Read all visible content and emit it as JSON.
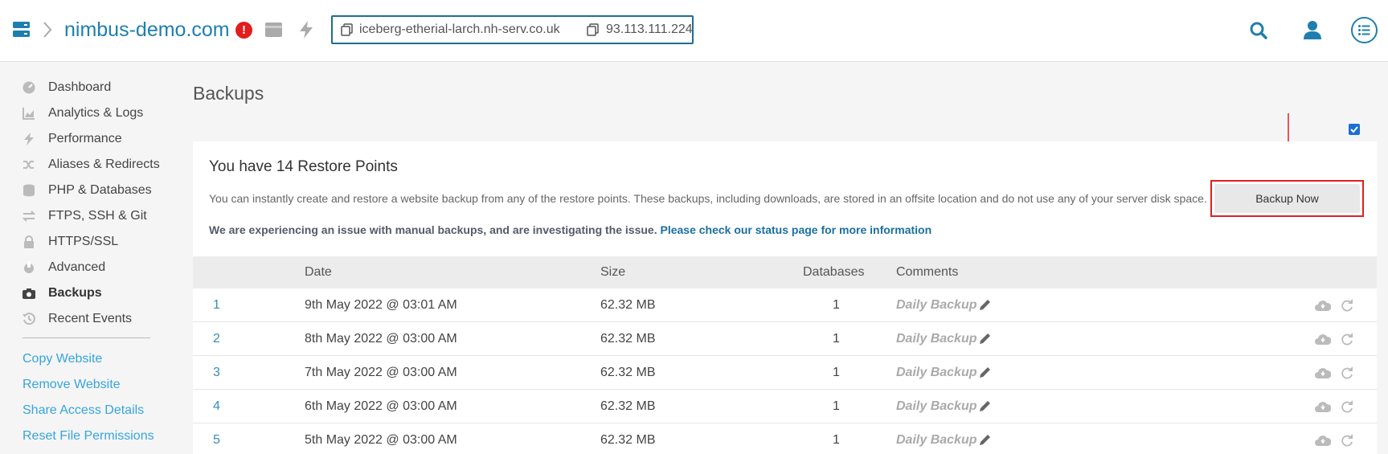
{
  "header": {
    "site_name": "nimbus-demo.com",
    "alert_glyph": "!",
    "hostname": "iceberg-etherial-larch.nh-serv.co.uk",
    "ip_address": "93.113.111.224"
  },
  "sidebar": {
    "items": [
      {
        "label": "Dashboard",
        "icon": "dashboard-icon"
      },
      {
        "label": "Analytics & Logs",
        "icon": "chart-icon"
      },
      {
        "label": "Performance",
        "icon": "bolt-icon"
      },
      {
        "label": "Aliases & Redirects",
        "icon": "shuffle-icon"
      },
      {
        "label": "PHP & Databases",
        "icon": "database-icon"
      },
      {
        "label": "FTPS, SSH & Git",
        "icon": "exchange-icon"
      },
      {
        "label": "HTTPS/SSL",
        "icon": "lock-icon"
      },
      {
        "label": "Advanced",
        "icon": "wrench-icon"
      },
      {
        "label": "Backups",
        "icon": "camera-icon",
        "active": true
      },
      {
        "label": "Recent Events",
        "icon": "history-icon"
      }
    ],
    "links": [
      "Copy Website",
      "Remove Website",
      "Share Access Details",
      "Reset File Permissions"
    ]
  },
  "main": {
    "title": "Backups",
    "panel_title": "You have 14 Restore Points",
    "description": "You can instantly create and restore a website backup from any of the restore points. These backups, including downloads, are stored in an offsite location and do not use any of your server disk space.",
    "warning_text": "We are experiencing an issue with manual backups, and are investigating the issue.",
    "warning_link": "Please check our status page for more information",
    "backup_button": "Backup Now",
    "columns": {
      "date": "Date",
      "size": "Size",
      "databases": "Databases",
      "comments": "Comments"
    },
    "rows": [
      {
        "num": "1",
        "date": "9th May 2022 @ 03:01 AM",
        "size": "62.32 MB",
        "databases": "1",
        "comment": "Daily Backup"
      },
      {
        "num": "2",
        "date": "8th May 2022 @ 03:00 AM",
        "size": "62.32 MB",
        "databases": "1",
        "comment": "Daily Backup"
      },
      {
        "num": "3",
        "date": "7th May 2022 @ 03:00 AM",
        "size": "62.32 MB",
        "databases": "1",
        "comment": "Daily Backup"
      },
      {
        "num": "4",
        "date": "6th May 2022 @ 03:00 AM",
        "size": "62.32 MB",
        "databases": "1",
        "comment": "Daily Backup"
      },
      {
        "num": "5",
        "date": "5th May 2022 @ 03:00 AM",
        "size": "62.32 MB",
        "databases": "1",
        "comment": "Daily Backup"
      }
    ]
  },
  "colors": {
    "accent": "#1e7fae",
    "link": "#36a5d8",
    "alert": "#e31c1c",
    "highlight": "#e02020"
  }
}
